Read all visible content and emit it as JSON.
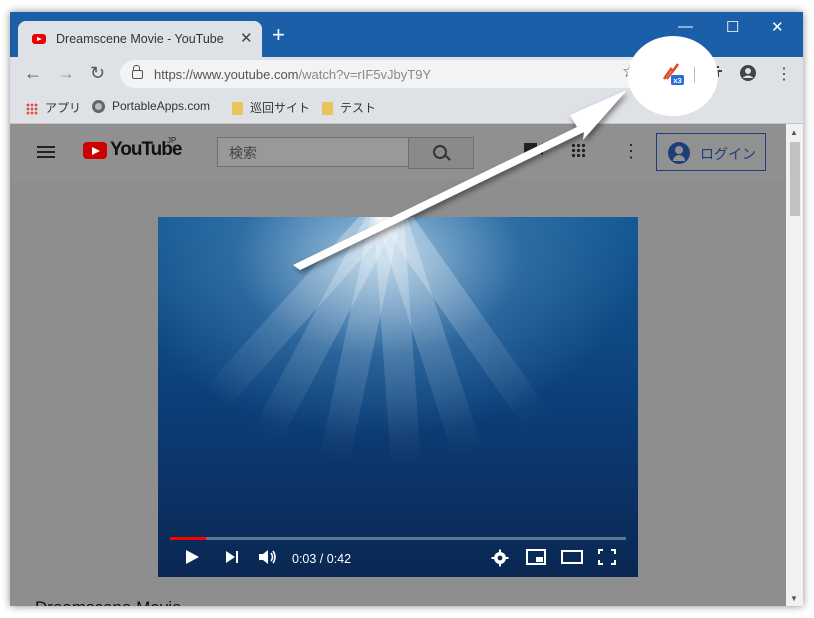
{
  "browser": {
    "tab_title": "Dreamscene Movie - YouTube",
    "tab_close": "✕",
    "new_tab": "+",
    "window_controls": {
      "minimize": "—",
      "maximize": "☐",
      "close": "✕"
    },
    "url_host": "https://www.youtube.com",
    "url_path": "/watch?v=rIF5vJbyT9Y",
    "nav": {
      "back": "←",
      "forward": "→",
      "reload": "↻"
    },
    "star": "☆",
    "menu": "⋮"
  },
  "bookmarks": [
    {
      "label": "アプリ",
      "icon": "apps-grid-icon"
    },
    {
      "label": "PortableApps.com",
      "icon": "globe-icon"
    },
    {
      "label": "巡回サイト",
      "icon": "folder-icon"
    },
    {
      "label": "テスト",
      "icon": "folder-icon"
    }
  ],
  "extension": {
    "badge": "x3",
    "icon": "speed-up-extension-icon"
  },
  "youtube": {
    "logo_text": "YouTube",
    "region": "JP",
    "search_placeholder": "検索",
    "login_label": "ログイン",
    "video_title": "Dreamscene Movie",
    "player": {
      "current_time": "0:03",
      "duration": "0:42",
      "time_display": "0:03 / 0:42",
      "progress": 0.08
    }
  },
  "colors": {
    "titlebar": "#1a5fa8",
    "youtube_red": "#cc0000",
    "login_blue": "#1c3f7a",
    "progress": "#ff0000"
  }
}
